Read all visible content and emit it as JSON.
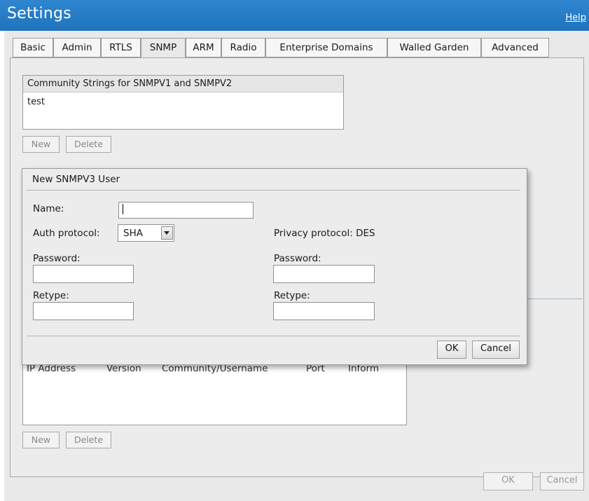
{
  "header": {
    "title": "Settings",
    "help": "Help"
  },
  "tabs": [
    "Basic",
    "Admin",
    "RTLS",
    "SNMP",
    "ARM",
    "Radio",
    "Enterprise Domains",
    "Walled Garden",
    "Advanced"
  ],
  "active_tab": "SNMP",
  "community": {
    "header": "Community Strings for SNMPV1 and SNMPV2",
    "rows": [
      "test"
    ],
    "new_label": "New",
    "delete_label": "Delete"
  },
  "trap": {
    "columns": [
      "IP Address",
      "Version",
      "Community/Username",
      "Port",
      "Inform"
    ],
    "new_label": "New",
    "delete_label": "Delete"
  },
  "dialog": {
    "title": "New SNMPV3 User",
    "name_label": "Name:",
    "name_value": "",
    "auth_label": "Auth protocol:",
    "auth_value": "SHA",
    "privacy_label": "Privacy protocol: DES",
    "auth_password_label": "Password:",
    "auth_retype_label": "Retype:",
    "privacy_password_label": "Password:",
    "privacy_retype_label": "Retype:",
    "ok_label": "OK",
    "cancel_label": "Cancel"
  },
  "footer": {
    "ok_label": "OK",
    "cancel_label": "Cancel"
  },
  "colors": {
    "titlebar": "#1f73bd",
    "panel": "#ececec"
  }
}
